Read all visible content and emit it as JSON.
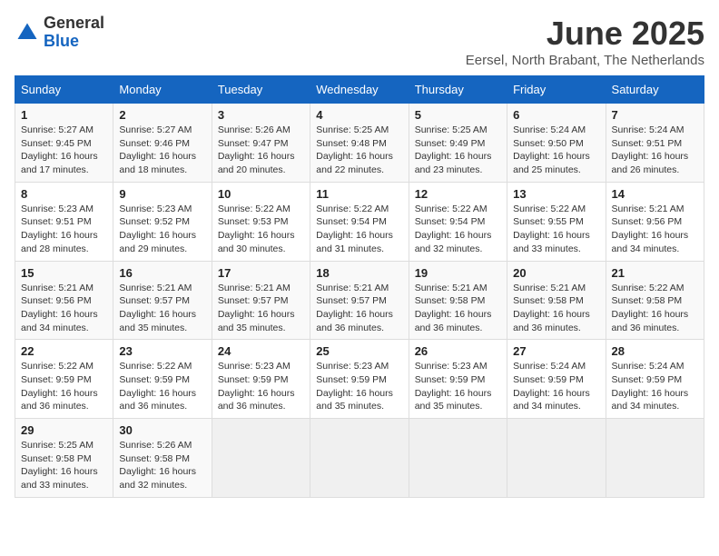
{
  "header": {
    "logo_general": "General",
    "logo_blue": "Blue",
    "month_title": "June 2025",
    "location": "Eersel, North Brabant, The Netherlands"
  },
  "weekdays": [
    "Sunday",
    "Monday",
    "Tuesday",
    "Wednesday",
    "Thursday",
    "Friday",
    "Saturday"
  ],
  "weeks": [
    [
      {
        "day": "1",
        "sunrise": "5:27 AM",
        "sunset": "9:45 PM",
        "daylight": "16 hours and 17 minutes."
      },
      {
        "day": "2",
        "sunrise": "5:27 AM",
        "sunset": "9:46 PM",
        "daylight": "16 hours and 18 minutes."
      },
      {
        "day": "3",
        "sunrise": "5:26 AM",
        "sunset": "9:47 PM",
        "daylight": "16 hours and 20 minutes."
      },
      {
        "day": "4",
        "sunrise": "5:25 AM",
        "sunset": "9:48 PM",
        "daylight": "16 hours and 22 minutes."
      },
      {
        "day": "5",
        "sunrise": "5:25 AM",
        "sunset": "9:49 PM",
        "daylight": "16 hours and 23 minutes."
      },
      {
        "day": "6",
        "sunrise": "5:24 AM",
        "sunset": "9:50 PM",
        "daylight": "16 hours and 25 minutes."
      },
      {
        "day": "7",
        "sunrise": "5:24 AM",
        "sunset": "9:51 PM",
        "daylight": "16 hours and 26 minutes."
      }
    ],
    [
      {
        "day": "8",
        "sunrise": "5:23 AM",
        "sunset": "9:51 PM",
        "daylight": "16 hours and 28 minutes."
      },
      {
        "day": "9",
        "sunrise": "5:23 AM",
        "sunset": "9:52 PM",
        "daylight": "16 hours and 29 minutes."
      },
      {
        "day": "10",
        "sunrise": "5:22 AM",
        "sunset": "9:53 PM",
        "daylight": "16 hours and 30 minutes."
      },
      {
        "day": "11",
        "sunrise": "5:22 AM",
        "sunset": "9:54 PM",
        "daylight": "16 hours and 31 minutes."
      },
      {
        "day": "12",
        "sunrise": "5:22 AM",
        "sunset": "9:54 PM",
        "daylight": "16 hours and 32 minutes."
      },
      {
        "day": "13",
        "sunrise": "5:22 AM",
        "sunset": "9:55 PM",
        "daylight": "16 hours and 33 minutes."
      },
      {
        "day": "14",
        "sunrise": "5:21 AM",
        "sunset": "9:56 PM",
        "daylight": "16 hours and 34 minutes."
      }
    ],
    [
      {
        "day": "15",
        "sunrise": "5:21 AM",
        "sunset": "9:56 PM",
        "daylight": "16 hours and 34 minutes."
      },
      {
        "day": "16",
        "sunrise": "5:21 AM",
        "sunset": "9:57 PM",
        "daylight": "16 hours and 35 minutes."
      },
      {
        "day": "17",
        "sunrise": "5:21 AM",
        "sunset": "9:57 PM",
        "daylight": "16 hours and 35 minutes."
      },
      {
        "day": "18",
        "sunrise": "5:21 AM",
        "sunset": "9:57 PM",
        "daylight": "16 hours and 36 minutes."
      },
      {
        "day": "19",
        "sunrise": "5:21 AM",
        "sunset": "9:58 PM",
        "daylight": "16 hours and 36 minutes."
      },
      {
        "day": "20",
        "sunrise": "5:21 AM",
        "sunset": "9:58 PM",
        "daylight": "16 hours and 36 minutes."
      },
      {
        "day": "21",
        "sunrise": "5:22 AM",
        "sunset": "9:58 PM",
        "daylight": "16 hours and 36 minutes."
      }
    ],
    [
      {
        "day": "22",
        "sunrise": "5:22 AM",
        "sunset": "9:59 PM",
        "daylight": "16 hours and 36 minutes."
      },
      {
        "day": "23",
        "sunrise": "5:22 AM",
        "sunset": "9:59 PM",
        "daylight": "16 hours and 36 minutes."
      },
      {
        "day": "24",
        "sunrise": "5:23 AM",
        "sunset": "9:59 PM",
        "daylight": "16 hours and 36 minutes."
      },
      {
        "day": "25",
        "sunrise": "5:23 AM",
        "sunset": "9:59 PM",
        "daylight": "16 hours and 35 minutes."
      },
      {
        "day": "26",
        "sunrise": "5:23 AM",
        "sunset": "9:59 PM",
        "daylight": "16 hours and 35 minutes."
      },
      {
        "day": "27",
        "sunrise": "5:24 AM",
        "sunset": "9:59 PM",
        "daylight": "16 hours and 34 minutes."
      },
      {
        "day": "28",
        "sunrise": "5:24 AM",
        "sunset": "9:59 PM",
        "daylight": "16 hours and 34 minutes."
      }
    ],
    [
      {
        "day": "29",
        "sunrise": "5:25 AM",
        "sunset": "9:58 PM",
        "daylight": "16 hours and 33 minutes."
      },
      {
        "day": "30",
        "sunrise": "5:26 AM",
        "sunset": "9:58 PM",
        "daylight": "16 hours and 32 minutes."
      },
      null,
      null,
      null,
      null,
      null
    ]
  ]
}
